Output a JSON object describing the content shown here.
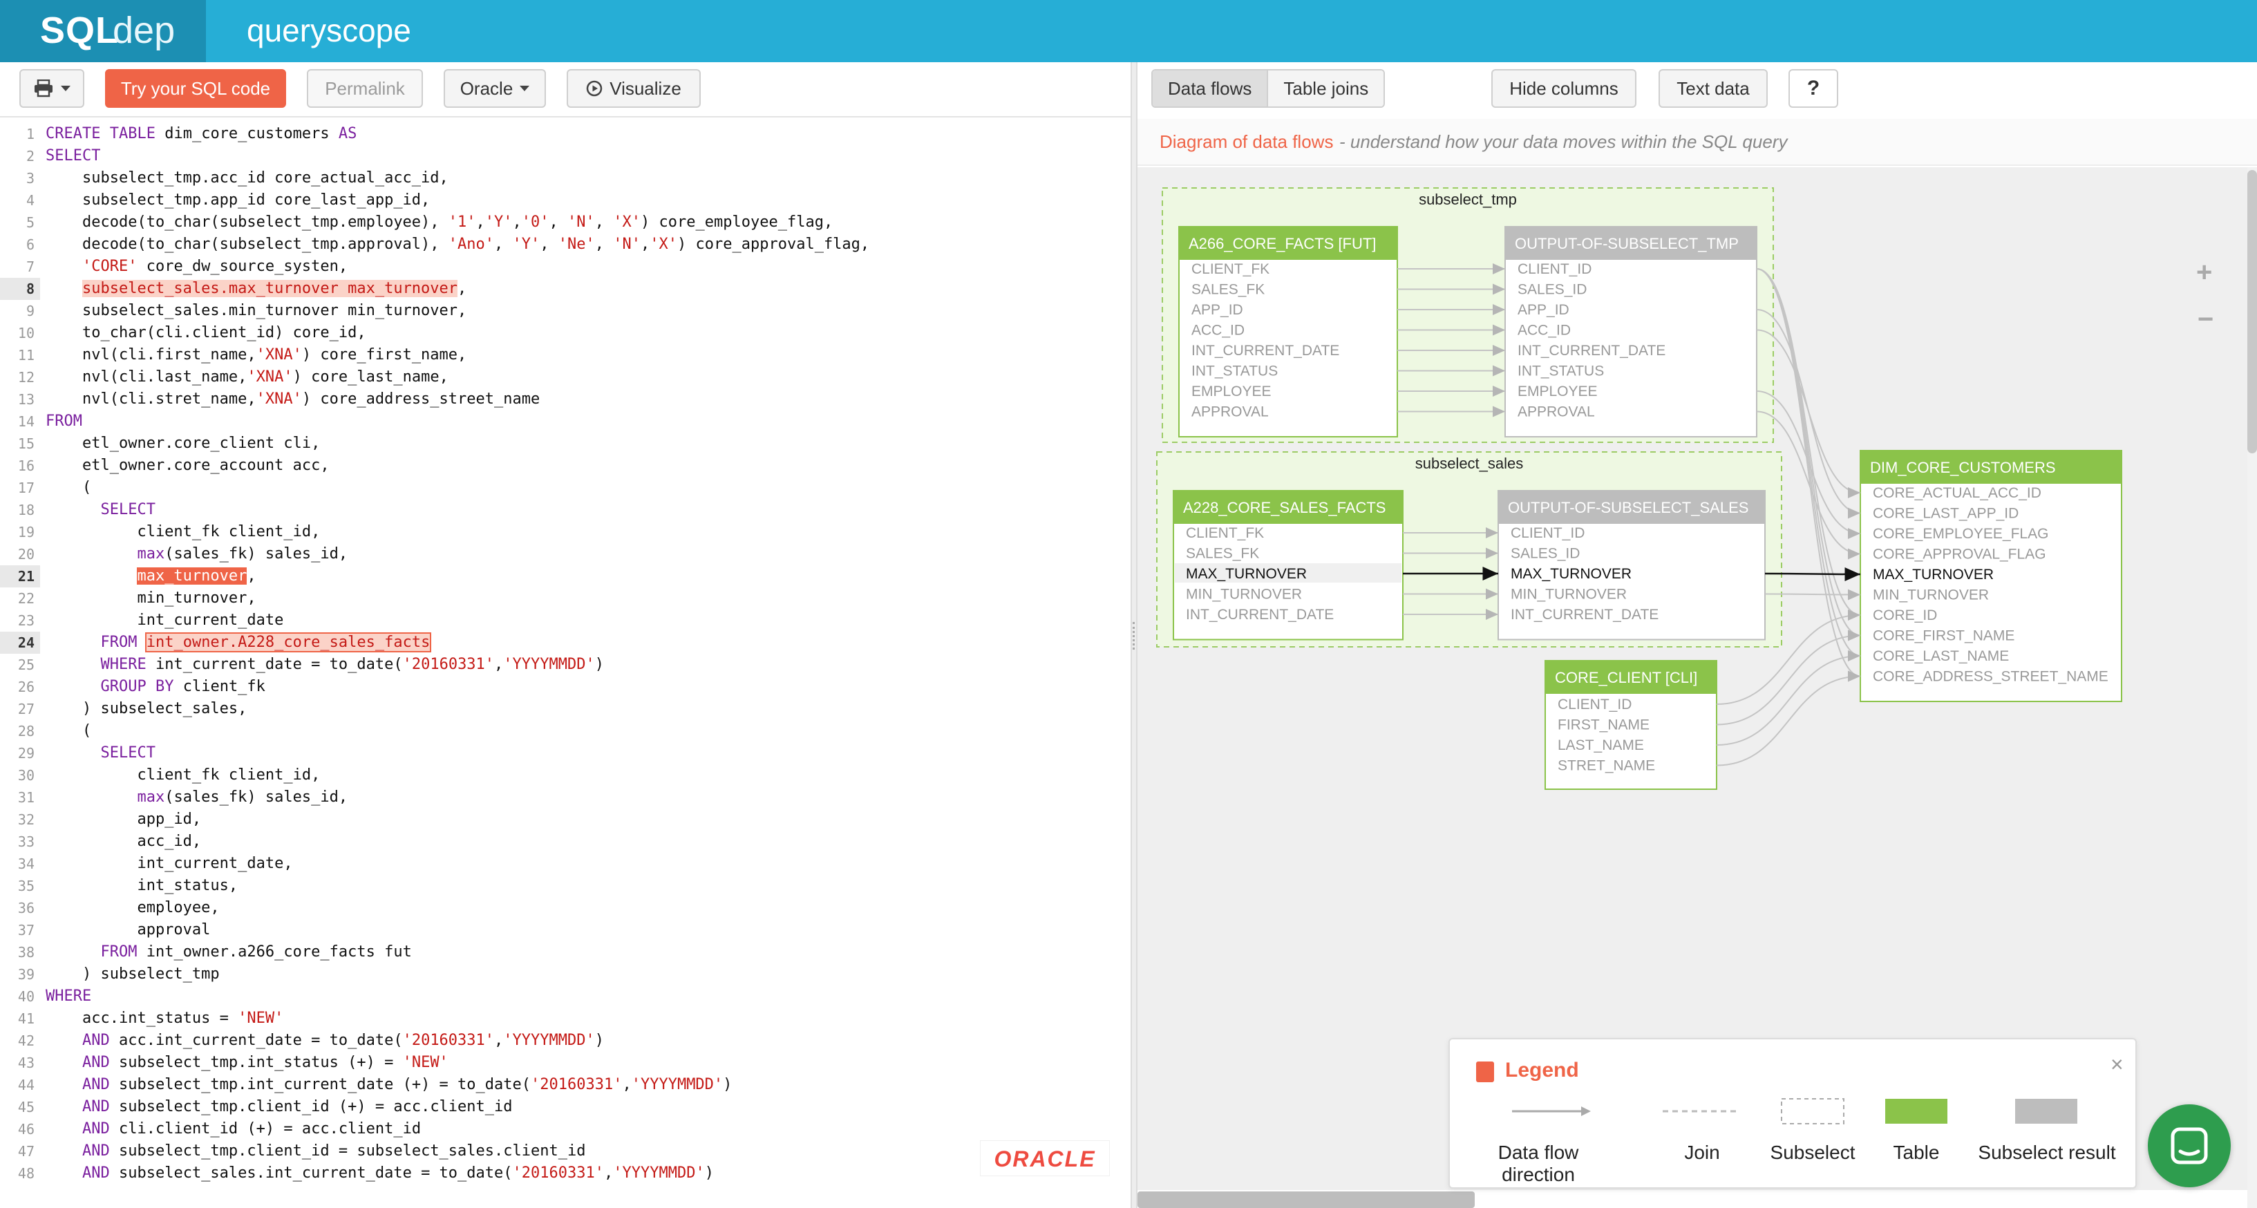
{
  "app": {
    "logo_bold": "SQL",
    "logo_light": "dep",
    "name": "queryscope"
  },
  "toolbar": {
    "print_icon": "printer-icon",
    "try_label": "Try your SQL code",
    "permalink_label": "Permalink",
    "dialect_label": "Oracle",
    "visualize_label": "Visualize"
  },
  "right_toolbar": {
    "tab_data_flows": "Data flows",
    "tab_table_joins": "Table joins",
    "hide_columns": "Hide columns",
    "text_data": "Text data",
    "help": "?"
  },
  "editor": {
    "current_lines": [
      8,
      21,
      24
    ],
    "lines": [
      "CREATE TABLE dim_core_customers AS",
      "SELECT",
      "    subselect_tmp.acc_id core_actual_acc_id,",
      "    subselect_tmp.app_id core_last_app_id,",
      "    decode(to_char(subselect_tmp.employee), '1','Y','0', 'N', 'X') core_employee_flag,",
      "    decode(to_char(subselect_tmp.approval), 'Ano', 'Y', 'Ne', 'N','X') core_approval_flag,",
      "    'CORE' core_dw_source_systen,",
      "    subselect_sales.max_turnover max_turnover,",
      "    subselect_sales.min_turnover min_turnover,",
      "    to_char(cli.client_id) core_id,",
      "    nvl(cli.first_name,'XNA') core_first_name,",
      "    nvl(cli.last_name,'XNA') core_last_name,",
      "    nvl(cli.stret_name,'XNA') core_address_street_name",
      "FROM",
      "    etl_owner.core_client cli,",
      "    etl_owner.core_account acc,",
      "    (",
      "      SELECT",
      "          client_fk client_id,",
      "          max(sales_fk) sales_id,",
      "          max_turnover,",
      "          min_turnover,",
      "          int_current_date",
      "      FROM int_owner.A228_core_sales_facts",
      "      WHERE int_current_date = to_date('20160331','YYYYMMDD')",
      "      GROUP BY client_fk",
      "    ) subselect_sales,",
      "    (",
      "      SELECT",
      "          client_fk client_id,",
      "          max(sales_fk) sales_id,",
      "          app_id,",
      "          acc_id,",
      "          int_current_date,",
      "          int_status,",
      "          employee,",
      "          approval",
      "      FROM int_owner.a266_core_facts fut",
      "    ) subselect_tmp",
      "WHERE",
      "    acc.int_status = 'NEW'",
      "    AND acc.int_current_date = to_date('20160331','YYYYMMDD')",
      "    AND subselect_tmp.int_status (+) = 'NEW'",
      "    AND subselect_tmp.int_current_date (+) = to_date('20160331','YYYYMMDD')",
      "    AND subselect_tmp.client_id (+) = acc.client_id",
      "    AND cli.client_id (+) = acc.client_id",
      "    AND subselect_tmp.client_id = subselect_sales.client_id",
      "    AND subselect_sales.int_current_date = to_date('20160331','YYYYMMDD')"
    ],
    "watermark": "ORACLE"
  },
  "diagram": {
    "title": "Diagram of data flows",
    "subtitle": "- understand how your data moves within the SQL query",
    "zoom_in": "+",
    "zoom_out": "−",
    "groups": [
      {
        "label": "subselect_tmp"
      },
      {
        "label": "subselect_sales"
      }
    ],
    "tables": {
      "a266": {
        "title": "A266_CORE_FACTS [FUT]",
        "kind": "table",
        "columns": [
          "CLIENT_FK",
          "SALES_FK",
          "APP_ID",
          "ACC_ID",
          "INT_CURRENT_DATE",
          "INT_STATUS",
          "EMPLOYEE",
          "APPROVAL"
        ]
      },
      "out_tmp": {
        "title": "OUTPUT-OF-SUBSELECT_TMP",
        "kind": "subselect",
        "columns": [
          "CLIENT_ID",
          "SALES_ID",
          "APP_ID",
          "ACC_ID",
          "INT_CURRENT_DATE",
          "INT_STATUS",
          "EMPLOYEE",
          "APPROVAL"
        ]
      },
      "a228": {
        "title": "A228_CORE_SALES_FACTS",
        "kind": "table",
        "columns": [
          "CLIENT_FK",
          "SALES_FK",
          "MAX_TURNOVER",
          "MIN_TURNOVER",
          "INT_CURRENT_DATE"
        ]
      },
      "out_sales": {
        "title": "OUTPUT-OF-SUBSELECT_SALES",
        "kind": "subselect",
        "columns": [
          "CLIENT_ID",
          "SALES_ID",
          "MAX_TURNOVER",
          "MIN_TURNOVER",
          "INT_CURRENT_DATE"
        ]
      },
      "cli": {
        "title": "CORE_CLIENT [CLI]",
        "kind": "table",
        "columns": [
          "CLIENT_ID",
          "FIRST_NAME",
          "LAST_NAME",
          "STRET_NAME"
        ]
      },
      "dim": {
        "title": "DIM_CORE_CUSTOMERS",
        "kind": "table",
        "columns": [
          "CORE_ACTUAL_ACC_ID",
          "CORE_LAST_APP_ID",
          "CORE_EMPLOYEE_FLAG",
          "CORE_APPROVAL_FLAG",
          "MAX_TURNOVER",
          "MIN_TURNOVER",
          "CORE_ID",
          "CORE_FIRST_NAME",
          "CORE_LAST_NAME",
          "CORE_ADDRESS_STREET_NAME"
        ]
      }
    },
    "highlighted_column": "MAX_TURNOVER"
  },
  "legend": {
    "title": "Legend",
    "close": "×",
    "items": [
      "Data flow direction",
      "Join",
      "Subselect",
      "Table",
      "Subselect result"
    ]
  },
  "colors": {
    "topbar": "#26aed6",
    "logo_bg": "#1c8fb3",
    "primary": "#ef6447",
    "table_header": "#8bc34a",
    "subselect_header": "#bdbdbd",
    "keyword": "#7a1f9e",
    "string": "#c41a16"
  }
}
